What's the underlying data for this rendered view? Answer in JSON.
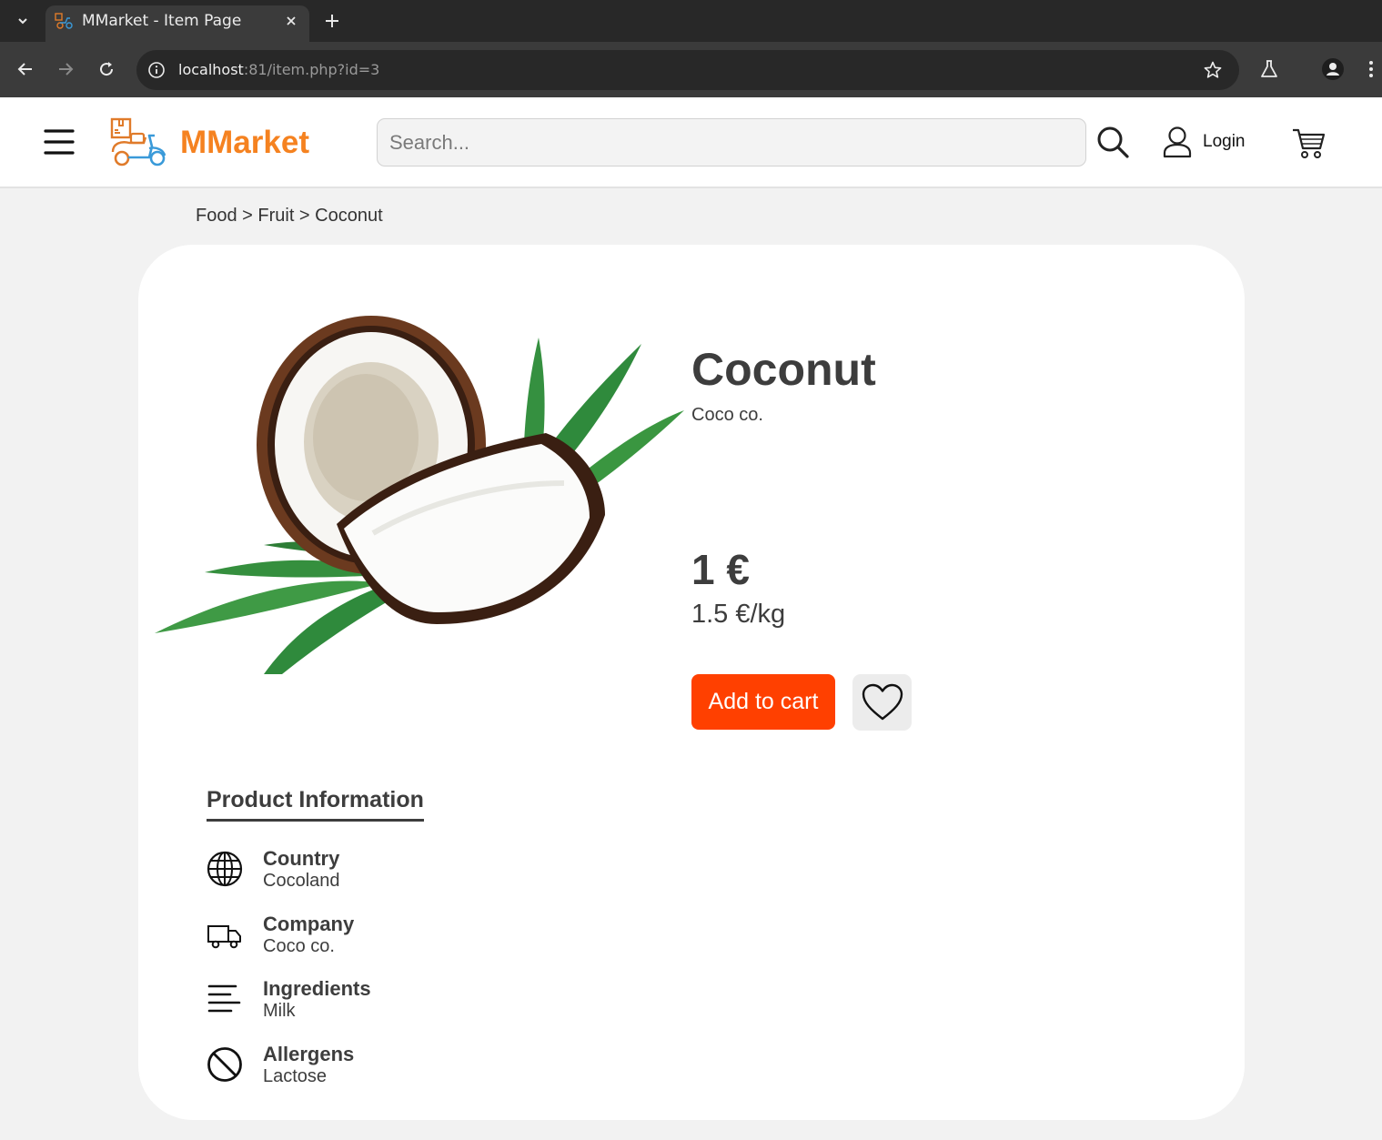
{
  "browser": {
    "tab_title": "MMarket - Item Page",
    "url_host": "localhost",
    "url_rest": ":81/item.php?id=3"
  },
  "header": {
    "logo_text": "MMarket",
    "search_placeholder": "Search...",
    "login_label": "Login"
  },
  "colors": {
    "brand_orange": "#f58220",
    "cta": "#ff4000",
    "text": "#3d3d3d"
  },
  "breadcrumb": "Food > Fruit > Coconut",
  "product": {
    "name": "Coconut",
    "brand": "Coco co.",
    "price": "1 €",
    "unit_price": "1.5 €/kg",
    "add_to_cart_label": "Add to cart"
  },
  "info": {
    "heading": "Product Information",
    "items": [
      {
        "label": "Country",
        "value": "Cocoland",
        "icon": "globe-icon"
      },
      {
        "label": "Company",
        "value": "Coco co.",
        "icon": "truck-icon"
      },
      {
        "label": "Ingredients",
        "value": "Milk",
        "icon": "list-lines-icon"
      },
      {
        "label": "Allergens",
        "value": "Lactose",
        "icon": "prohibited-icon"
      }
    ]
  }
}
